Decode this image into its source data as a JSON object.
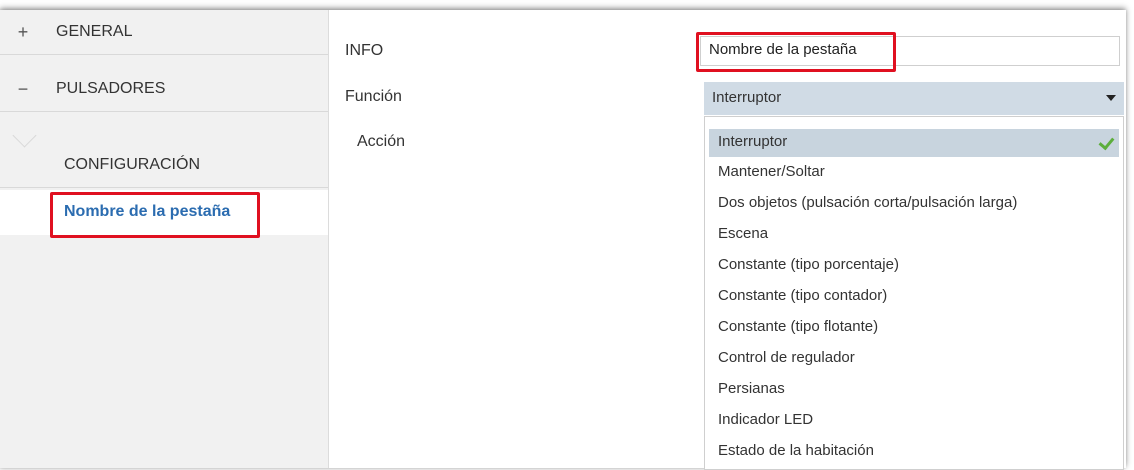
{
  "sidebar": {
    "groups": [
      {
        "sign": "+",
        "label": "GENERAL"
      },
      {
        "sign": "−",
        "label": "PULSADORES"
      }
    ],
    "subitems": [
      {
        "label": "CONFIGURACIÓN"
      },
      {
        "label": "Nombre de la pestaña"
      }
    ]
  },
  "main": {
    "info_label": "INFO",
    "info_value": "Nombre de la pestaña",
    "funcion_label": "Función",
    "funcion_value": "Interruptor",
    "accion_label": "Acción",
    "dropdown_options": [
      "Interruptor",
      "Mantener/Soltar",
      "Dos objetos (pulsación corta/pulsación larga)",
      "Escena",
      "Constante (tipo porcentaje)",
      "Constante (tipo contador)",
      "Constante (tipo flotante)",
      "Control de regulador",
      "Persianas",
      "Indicador LED",
      "Estado de la habitación"
    ],
    "selected_option": "Interruptor"
  },
  "colors": {
    "highlight": "#e01020",
    "active_tab_text": "#2b6cb0",
    "check": "#5cae3c"
  },
  "icons": [
    "expand-icon",
    "collapse-icon",
    "dropdown-caret-icon",
    "check-icon"
  ]
}
